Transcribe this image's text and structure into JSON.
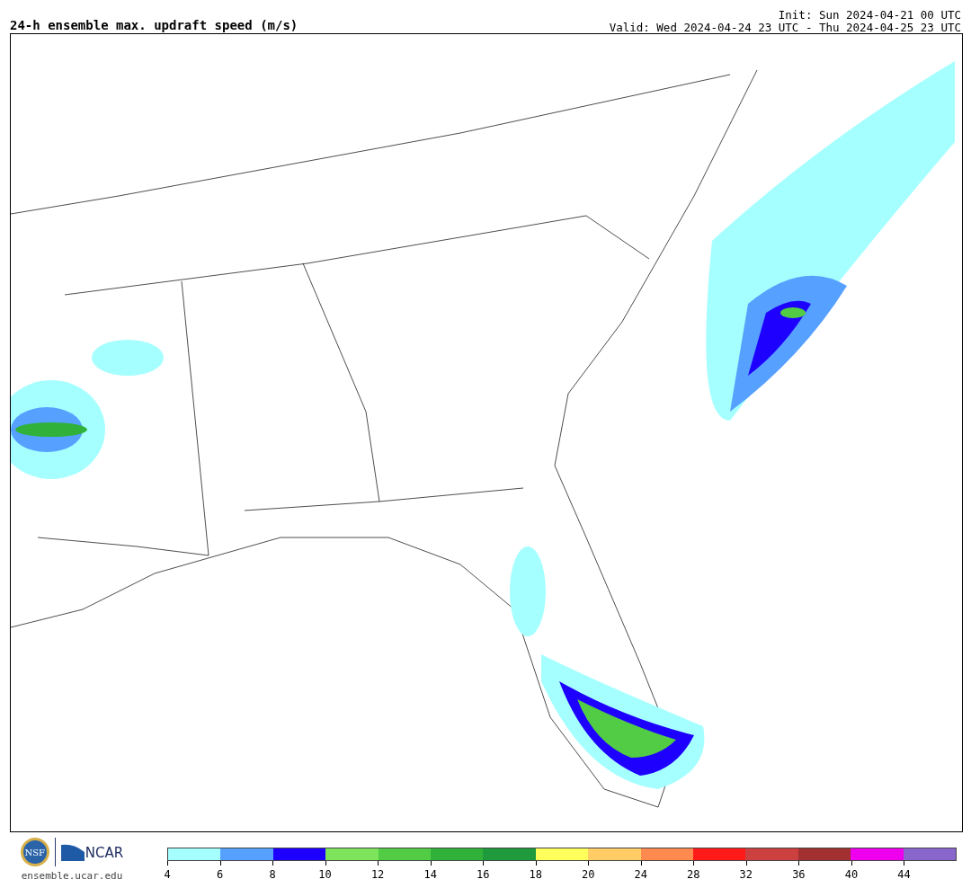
{
  "title": "24-h ensemble max. updraft speed (m/s)",
  "init": "Init: Sun 2024-04-21 00 UTC",
  "valid": "Valid: Wed 2024-04-24 23 UTC - Thu 2024-04-25 23 UTC",
  "footer": {
    "logo_left": "NSF",
    "logo_right": "NCAR",
    "url": "ensemble.ucar.edu"
  },
  "colorbar": [
    {
      "color": "#a6ffff",
      "tick": "4"
    },
    {
      "color": "#56a0ff",
      "tick": "6"
    },
    {
      "color": "#1e00ff",
      "tick": "8"
    },
    {
      "color": "#7ee45c",
      "tick": "10"
    },
    {
      "color": "#52cc44",
      "tick": "12"
    },
    {
      "color": "#30b23a",
      "tick": "14"
    },
    {
      "color": "#1f9a3c",
      "tick": "16"
    },
    {
      "color": "#ffff5c",
      "tick": "18"
    },
    {
      "color": "#ffcc66",
      "tick": "20"
    },
    {
      "color": "#ff8a50",
      "tick": "24"
    },
    {
      "color": "#ff1a1a",
      "tick": "28"
    },
    {
      "color": "#cc4040",
      "tick": "32"
    },
    {
      "color": "#a33030",
      "tick": "36"
    },
    {
      "color": "#ee00ee",
      "tick": "40"
    },
    {
      "color": "#8866cc",
      "tick": "44"
    }
  ]
}
